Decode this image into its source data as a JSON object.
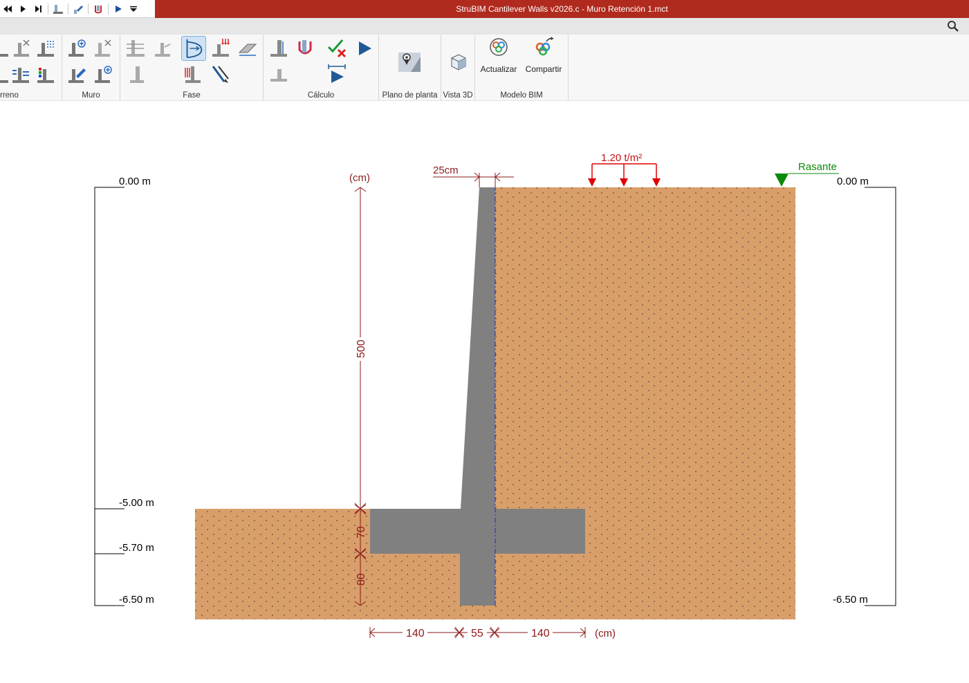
{
  "window": {
    "title": "StruBIM Cantilever Walls v2026.c - Muro Retención 1.mct"
  },
  "quick_access": {
    "icons": [
      "first-icon",
      "next-icon",
      "last-icon",
      "wall-icon",
      "edit-icon",
      "phase-icon",
      "run-icon",
      "menu-dropdown-icon"
    ]
  },
  "ribbon": {
    "groups": {
      "terreno": "rreno",
      "muro": "Muro",
      "fase": "Fase",
      "calculo": "Cálculo",
      "plano": "Plano de planta",
      "vista3d": "Vista 3D",
      "modelo_bim": "Modelo BIM"
    },
    "actualizar_label": "Actualizar",
    "compartir_label": "Compartir"
  },
  "colors": {
    "titlebar": "#b02a1e",
    "soil": "#d99f6a",
    "concrete": "#808080",
    "dimension": "#8b1a1a",
    "load": "#e00000",
    "rasante": "#0a8a0a"
  },
  "drawing": {
    "left_levels": {
      "top": "0.00 m",
      "excavation": "-5.00 m",
      "footing_base": "-5.70 m",
      "bottom": "-6.50 m"
    },
    "right_levels": {
      "top": "0.00 m",
      "bottom": "-6.50 m"
    },
    "units_top": "(cm)",
    "units_bottom": "(cm)",
    "wall_top_width": "25cm",
    "load_label": "1.20 t/m²",
    "rasante_label": "Rasante",
    "vertical_dims": {
      "stem_height": "500",
      "footing_thickness": "70",
      "key_depth": "80"
    },
    "horizontal_dims": {
      "toe": "140",
      "stem_base": "55",
      "heel": "140"
    }
  }
}
